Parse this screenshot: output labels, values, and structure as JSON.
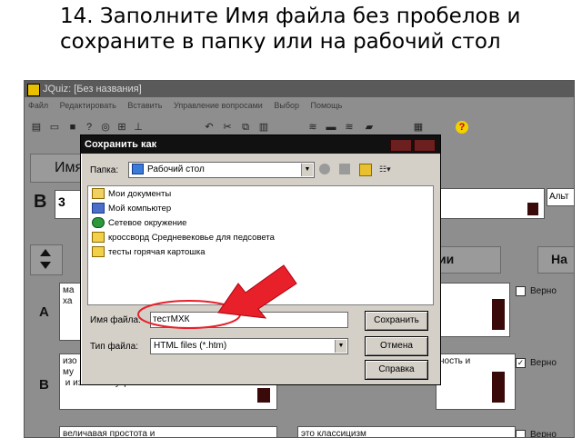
{
  "slide": {
    "title": "14. Заполните Имя файла без пробелов и сохраните в папку или на рабочий стол"
  },
  "app": {
    "title": "JQuiz: [Без названия]",
    "menu": [
      "Файл",
      "Редактировать",
      "Вставить",
      "Управление вопросами",
      "Выбор",
      "Помощь"
    ],
    "name_label_partial": "Имя",
    "question_letter": "B",
    "question_number": "3",
    "right_combo_partial": "Альт",
    "col_header_partial_1": "ии",
    "col_header_partial_2": "На",
    "answers": [
      {
        "letter": "A",
        "text": "ма\nха",
        "check_label": "Верно",
        "checked": false
      },
      {
        "letter": "B",
        "text": "изо\nму\n и изобилие украшений",
        "right_text": "ность и",
        "check_label": "Верно",
        "checked": true
      },
      {
        "letter": "",
        "text": "величавая простота и",
        "right_text": "это классицизм",
        "check_label": "Верно",
        "checked": false
      }
    ]
  },
  "dialog": {
    "title": "Сохранить как",
    "folder_label": "Папка:",
    "folder_value": "Рабочий стол",
    "files": [
      {
        "name": "Мои документы",
        "icon": "my-documents-icon"
      },
      {
        "name": "Мой компьютер",
        "icon": "computer-icon"
      },
      {
        "name": "Сетевое окружение",
        "icon": "network-icon"
      },
      {
        "name": "кроссворд Средневековье для педсовета",
        "icon": "folder-icon"
      },
      {
        "name": "тесты горячая картошка",
        "icon": "folder-icon"
      }
    ],
    "filename_label": "Имя файла:",
    "filename_value": "тестМХК",
    "filetype_label": "Тип файла:",
    "filetype_value": "HTML files (*.htm)",
    "save_button": "Сохранить",
    "cancel_button": "Отмена",
    "help_button": "Справка"
  },
  "colors": {
    "annotation_arrow": "#e8202a",
    "dialog_titlebar": "#111111",
    "dark_accent": "#3a0a0a"
  }
}
